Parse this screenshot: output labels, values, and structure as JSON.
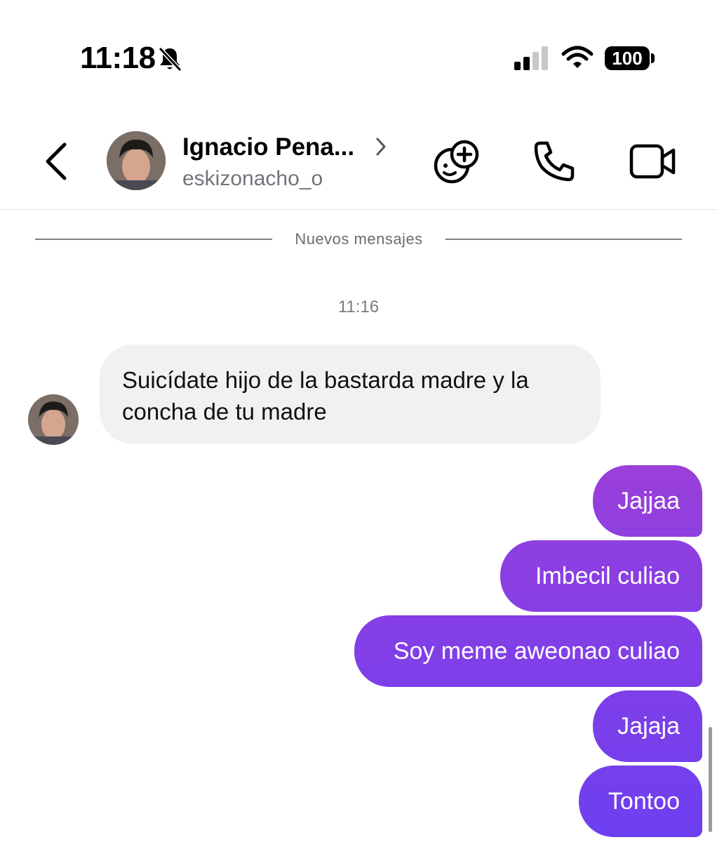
{
  "status_bar": {
    "time": "11:18",
    "battery": "100"
  },
  "header": {
    "contact_name": "Ignacio Pena...",
    "username": "eskizonacho_o"
  },
  "chat": {
    "new_messages_label": "Nuevos mensajes",
    "timestamp": "11:16",
    "incoming_text": "Suicídate hijo de la bastarda madre y la concha de tu madre",
    "outgoing": [
      {
        "text": "Jajjaa"
      },
      {
        "text": "Imbecil culiao"
      },
      {
        "text": "Soy meme aweonao culiao"
      },
      {
        "text": "Jajaja"
      },
      {
        "text": "Tontoo"
      }
    ]
  },
  "colors": {
    "outgoing_gradient_top": "#9b3fd9",
    "outgoing_gradient_bottom": "#6d3ff0",
    "incoming_bubble": "#f1f1f4"
  },
  "icons": [
    "bell-slash-icon",
    "signal-icon",
    "wifi-icon",
    "back-arrow-icon",
    "chevron-right-icon",
    "effects-icon",
    "phone-icon",
    "video-camera-icon"
  ]
}
